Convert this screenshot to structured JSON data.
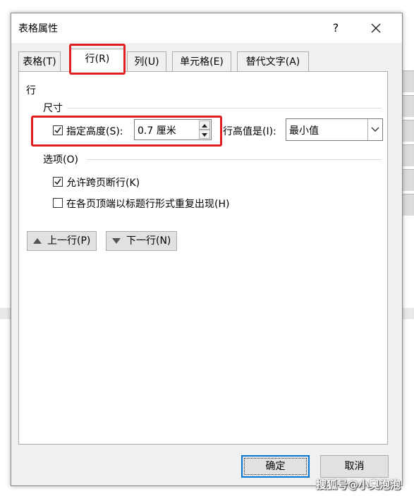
{
  "window": {
    "title": "表格属性",
    "help_label": "?"
  },
  "tabs": [
    {
      "label": "表格(T)"
    },
    {
      "label": "行(R)"
    },
    {
      "label": "列(U)"
    },
    {
      "label": "单元格(E)"
    },
    {
      "label": "替代文字(A)"
    }
  ],
  "active_tab": "行(R)",
  "panel": {
    "heading": "行",
    "size_group": {
      "label": "尺寸",
      "specify_height_label": "指定高度(S):",
      "specify_height_checked": true,
      "height_value": "0.7 厘米",
      "row_height_is_label": "行高值是(I):",
      "row_height_is_value": "最小值"
    },
    "options_group": {
      "label": "选项(O)",
      "allow_break_label": "允许跨页断行(K)",
      "allow_break_checked": true,
      "repeat_header_label": "在各页顶端以标题行形式重复出现(H)",
      "repeat_header_checked": false
    },
    "prev_row_label": "上一行(P)",
    "next_row_label": "下一行(N)"
  },
  "buttons": {
    "ok": "确定",
    "cancel": "取消"
  },
  "watermark": "搜狐号@小奥泡泡",
  "colors": {
    "highlight": "#e02020",
    "default_button_border": "#0078d7"
  }
}
